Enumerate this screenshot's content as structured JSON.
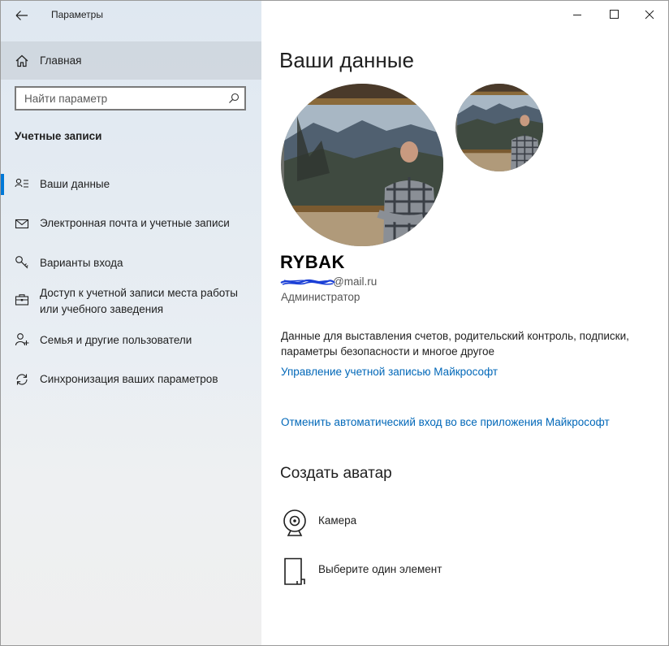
{
  "window": {
    "app_title": "Параметры",
    "controls": [
      "minimize-icon",
      "maximize-icon",
      "close-icon"
    ]
  },
  "sidebar": {
    "home_label": "Главная",
    "search": {
      "placeholder": "Найти параметр",
      "value": ""
    },
    "section_title": "Учетные записи",
    "items": [
      {
        "label": "Ваши данные",
        "icon": "person-card-icon",
        "active": true
      },
      {
        "label": "Электронная почта и учетные записи",
        "icon": "mail-icon",
        "active": false
      },
      {
        "label": "Варианты входа",
        "icon": "key-icon",
        "active": false
      },
      {
        "label": "Доступ к учетной записи места работы или учебного заведения",
        "line1": "Доступ к учетной записи места работы",
        "line2": "или учебного заведения",
        "icon": "briefcase-icon",
        "active": false
      },
      {
        "label": "Семья и другие пользователи",
        "icon": "person-add-icon",
        "active": false
      },
      {
        "label": "Синхронизация ваших параметров",
        "icon": "sync-icon",
        "active": false
      }
    ]
  },
  "main": {
    "title": "Ваши данные",
    "user": {
      "name": "RYBAK",
      "email_visible_suffix": "@mail.ru",
      "role": "Администратор"
    },
    "description": "Данные для выставления счетов, родительский контроль, подписки, параметры безопасности и многое другое",
    "links": {
      "manage_account": "Управление учетной записью Майкрософт",
      "stop_auto_signin": "Отменить автоматический вход во все приложения Майкрософт"
    },
    "create_avatar": {
      "heading": "Создать аватар",
      "options": [
        {
          "label": "Камера",
          "icon": "camera-icon"
        },
        {
          "label": "Выберите один элемент",
          "icon": "browse-file-icon"
        }
      ]
    }
  },
  "colors": {
    "accent": "#0078d7",
    "link": "#0067b8",
    "sidebar_top": "#dfe8f1",
    "sidebar_bottom": "#efefef"
  }
}
